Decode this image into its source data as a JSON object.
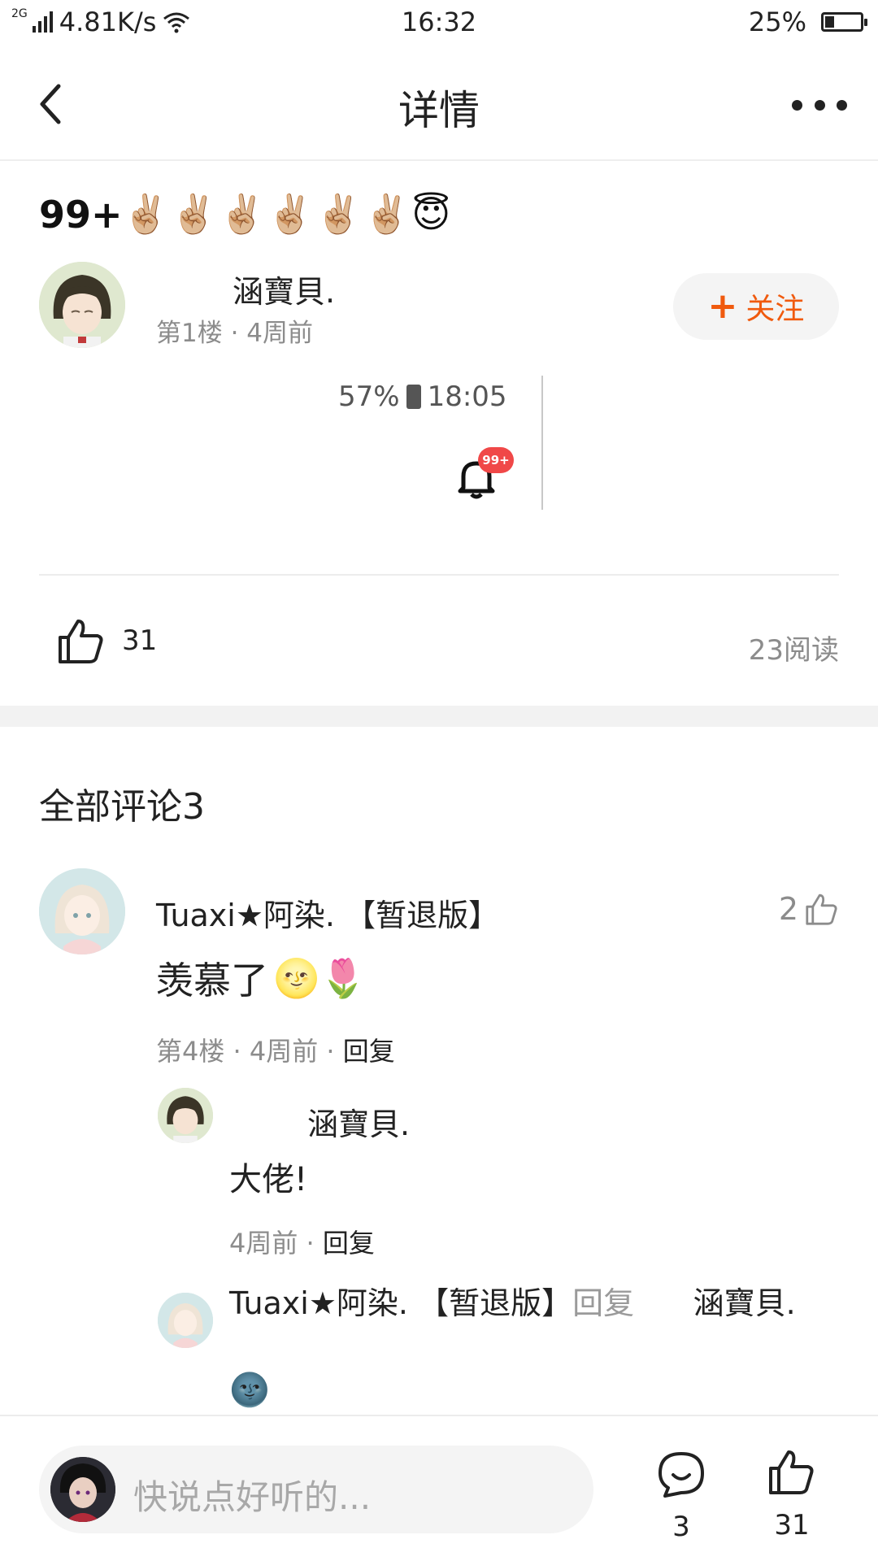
{
  "status_bar": {
    "network_type": "2G",
    "speed": "4.81K/s",
    "time": "16:32",
    "battery": "25%",
    "battery_level": 0.25
  },
  "header": {
    "title": "详情"
  },
  "post": {
    "title_prefix": "99+",
    "title_emojis": "✌🏼✌🏼✌🏼✌🏼✌🏼✌🏼😇",
    "author_name": "涵寶貝.",
    "meta": "第1楼 · 4周前",
    "follow_label": "关注",
    "follow_plus": "+",
    "embedded": {
      "status": "57%",
      "time": "18:05",
      "badge": "99+"
    },
    "likes": "31",
    "reads": "23阅读"
  },
  "comments": {
    "title": "全部评论3",
    "items": [
      {
        "name": "Tuaxi★阿染. 【暂退版】",
        "likes": "2",
        "text": "羡慕了",
        "emojis": "🌝🌷",
        "meta": "第4楼 · 4周前 · ",
        "reply_label": "回复",
        "replies": [
          {
            "name": "涵寶貝.",
            "text": "大佬!",
            "meta": "4周前 · ",
            "reply_label": "回复"
          },
          {
            "name": "Tuaxi★阿染. 【暂退版】",
            "reply_word": "回复",
            "target": "涵寶貝.",
            "emoji": "🌚"
          }
        ]
      }
    ]
  },
  "bottom_bar": {
    "placeholder": "快说点好听的...",
    "comment_count": "3",
    "like_count": "31"
  },
  "colors": {
    "accent": "#f05a0e",
    "muted": "#8c8c8c",
    "badge": "#f04848"
  }
}
